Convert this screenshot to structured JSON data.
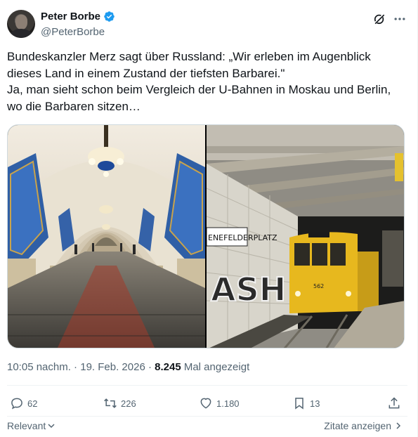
{
  "author": {
    "display_name": "Peter Borbe",
    "handle": "@PeterBorbe"
  },
  "tweet": {
    "text": "Bundeskanzler Merz sagt über Russland: „Wir erleben im Augenblick\ndieses Land in einem Zustand der tiefsten Barbarei.\"\nJa, man sieht schon beim Vergleich der U-Bahnen in Moskau und Berlin,\nwo die Barbaren sitzen…"
  },
  "media": {
    "left_image": "moscow-metro-station",
    "right_image": "berlin-ubahn-station",
    "station_sign": "ENEFELDERPLATZ",
    "graffiti": "ASH",
    "train_number": "562"
  },
  "meta": {
    "timestamp": "10:05 nachm. · 19. Feb. 2026 · ",
    "views_count": "8.245",
    "views_label": " Mal angezeigt"
  },
  "actions": {
    "replies": "62",
    "reposts": "226",
    "likes": "1.180",
    "bookmarks": "13"
  },
  "footer": {
    "sort_label": "Relevant",
    "quotes_label": "Zitate anzeigen"
  },
  "colors": {
    "verified": "#1d9bf0",
    "text_secondary": "#536471",
    "text_primary": "#0f1419"
  }
}
